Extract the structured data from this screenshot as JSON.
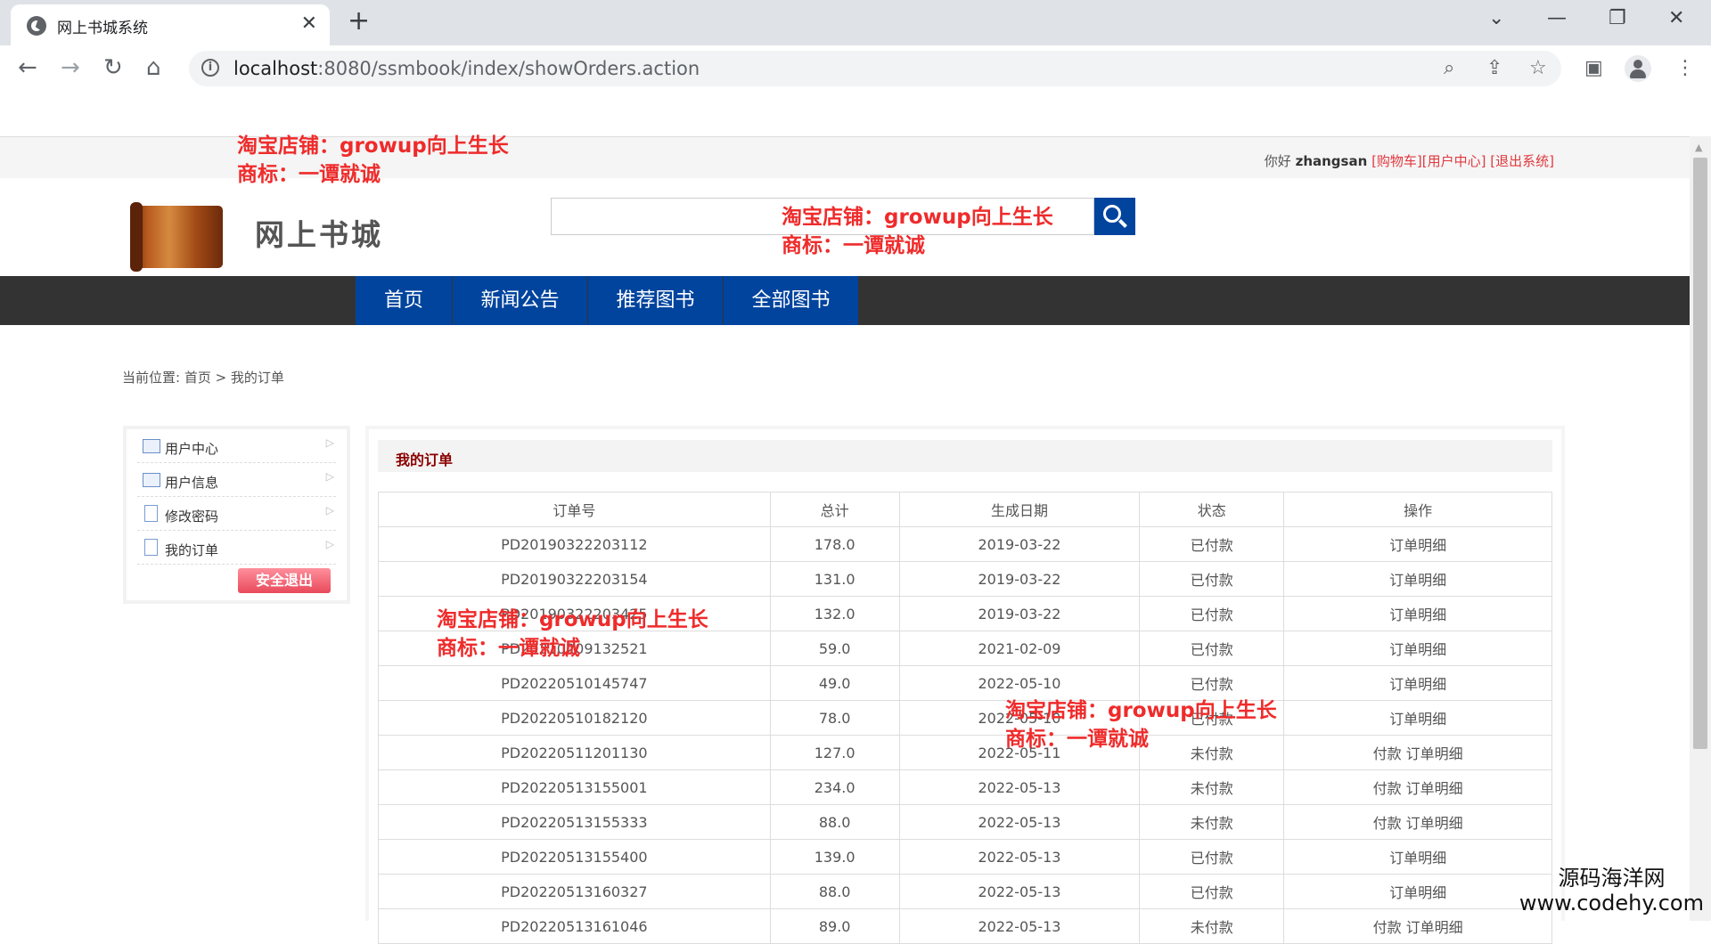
{
  "browser": {
    "tab_title": "网上书城系统",
    "tab_close": "✕",
    "new_tab": "+",
    "window_controls": {
      "chevron": "⌄",
      "minimize": "—",
      "restore": "❐",
      "close": "✕"
    },
    "address_host": "localhost",
    "address_rest": ":8080/ssmbook/index/showOrders.action",
    "icons": [
      "back-icon",
      "forward-icon",
      "reload-icon",
      "home-icon",
      "info-icon",
      "zoom-icon",
      "share-icon",
      "star-icon",
      "sidepanel-icon",
      "profile-icon",
      "menu-icon"
    ]
  },
  "topbar": {
    "greeting": "你好",
    "username": "zhangsan",
    "links": [
      "[购物车]",
      "[用户中心]",
      "[退出系统]"
    ]
  },
  "header": {
    "logo_text": "网上书城",
    "search_value": ""
  },
  "nav": {
    "items": [
      {
        "label": "首页"
      },
      {
        "label": "新闻公告"
      },
      {
        "label": "推荐图书"
      },
      {
        "label": "全部图书"
      }
    ]
  },
  "breadcrumb": "当前位置: 首页 >  我的订单",
  "sidebar": {
    "items": [
      {
        "label": "用户中心"
      },
      {
        "label": "用户信息"
      },
      {
        "label": "修改密码"
      },
      {
        "label": "我的订单"
      }
    ],
    "logout": "安全退出"
  },
  "orders": {
    "title": "我的订单",
    "headers": [
      "订单号",
      "总计",
      "生成日期",
      "状态",
      "操作"
    ],
    "rows": [
      {
        "id": "PD20190322203112",
        "total": "178.0",
        "date": "2019-03-22",
        "status": "已付款",
        "op": "订单明细"
      },
      {
        "id": "PD20190322203154",
        "total": "131.0",
        "date": "2019-03-22",
        "status": "已付款",
        "op": "订单明细"
      },
      {
        "id": "PD20190322203425",
        "total": "132.0",
        "date": "2019-03-22",
        "status": "已付款",
        "op": "订单明细"
      },
      {
        "id": "PD20210209132521",
        "total": "59.0",
        "date": "2021-02-09",
        "status": "已付款",
        "op": "订单明细"
      },
      {
        "id": "PD20220510145747",
        "total": "49.0",
        "date": "2022-05-10",
        "status": "已付款",
        "op": "订单明细"
      },
      {
        "id": "PD20220510182120",
        "total": "78.0",
        "date": "2022-05-10",
        "status": "已付款",
        "op": "订单明细"
      },
      {
        "id": "PD20220511201130",
        "total": "127.0",
        "date": "2022-05-11",
        "status": "未付款",
        "op": "付款 订单明细"
      },
      {
        "id": "PD20220513155001",
        "total": "234.0",
        "date": "2022-05-13",
        "status": "未付款",
        "op": "付款 订单明细"
      },
      {
        "id": "PD20220513155333",
        "total": "88.0",
        "date": "2022-05-13",
        "status": "未付款",
        "op": "付款 订单明细"
      },
      {
        "id": "PD20220513155400",
        "total": "139.0",
        "date": "2022-05-13",
        "status": "已付款",
        "op": "订单明细"
      },
      {
        "id": "PD20220513160327",
        "total": "88.0",
        "date": "2022-05-13",
        "status": "已付款",
        "op": "订单明细"
      },
      {
        "id": "PD20220513161046",
        "total": "89.0",
        "date": "2022-05-13",
        "status": "未付款",
        "op": "付款 订单明细"
      }
    ]
  },
  "watermarks": {
    "line1": "淘宝店铺：growup向上生长",
    "line2": "商标：一谭就诚",
    "site_name": "源码海洋网",
    "site_url": "www.codehy.com"
  }
}
